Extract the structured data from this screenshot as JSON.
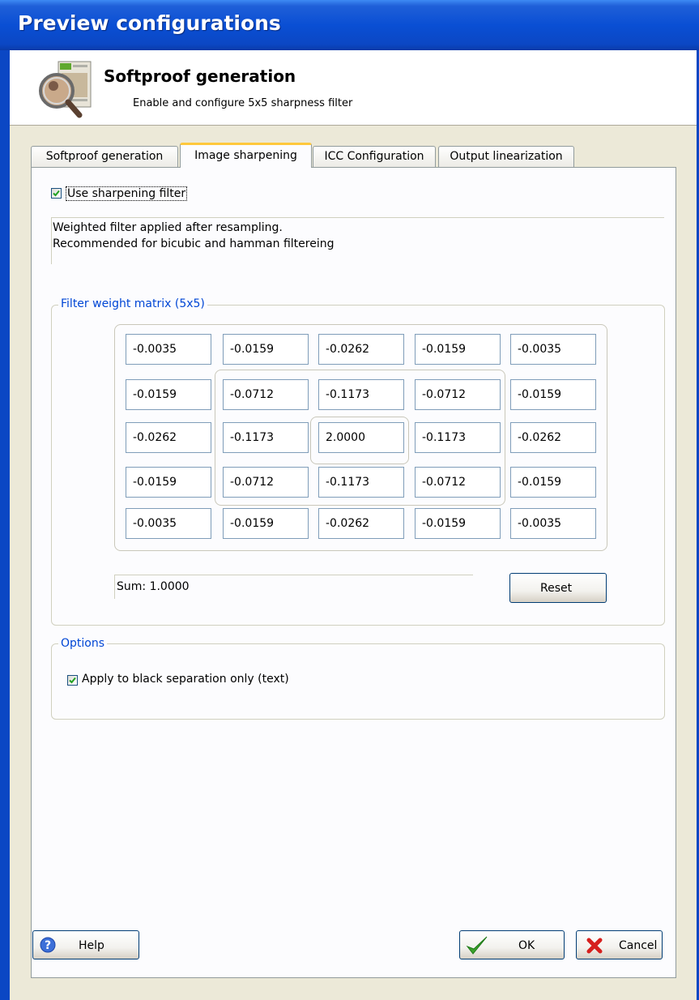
{
  "window": {
    "title": "Preview configurations"
  },
  "header": {
    "title": "Softproof generation",
    "subtitle": "Enable and configure 5x5 sharpness filter",
    "icon": "softproof-magnifier-icon"
  },
  "tabs": [
    {
      "label": "Softproof generation",
      "active": false
    },
    {
      "label": "Image sharpening",
      "active": true
    },
    {
      "label": "ICC Configuration",
      "active": false
    },
    {
      "label": "Output linearization",
      "active": false
    }
  ],
  "sharpening": {
    "use_filter_label": "Use sharpening filter",
    "use_filter_checked": true,
    "description_line1": "Weighted filter applied after resampling.",
    "description_line2": "Recommended for bicubic and hamman filtereing"
  },
  "matrix": {
    "label": "Filter weight matrix (5x5)",
    "rows": [
      [
        "-0.0035",
        "-0.0159",
        "-0.0262",
        "-0.0159",
        "-0.0035"
      ],
      [
        "-0.0159",
        "-0.0712",
        "-0.1173",
        "-0.0712",
        "-0.0159"
      ],
      [
        "-0.0262",
        "-0.1173",
        "2.0000",
        "-0.1173",
        "-0.0262"
      ],
      [
        "-0.0159",
        "-0.0712",
        "-0.1173",
        "-0.0712",
        "-0.0159"
      ],
      [
        "-0.0035",
        "-0.0159",
        "-0.0262",
        "-0.0159",
        "-0.0035"
      ]
    ],
    "sum_text": "Sum: 1.0000",
    "reset_label": "Reset"
  },
  "options": {
    "label": "Options",
    "black_only_label": "Apply to black separation only (text)",
    "black_only_checked": true
  },
  "buttons": {
    "help_label": "Help",
    "ok_label": "OK",
    "cancel_label": "Cancel"
  },
  "colors": {
    "title_bar": "#0A4FD4",
    "group_label": "#0046D5",
    "active_tab_accent": "#FFC83C",
    "ok_check": "#3BA12B",
    "cancel_x": "#D6201E"
  }
}
